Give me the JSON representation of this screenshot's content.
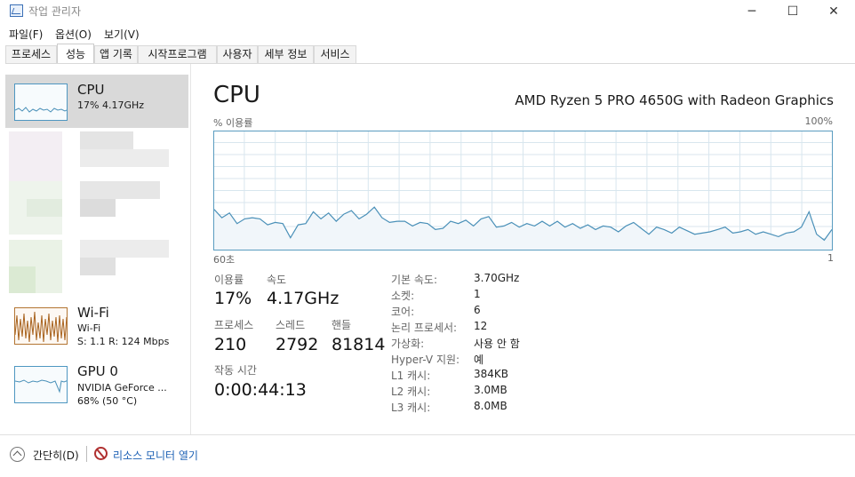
{
  "window": {
    "title": "작업 관리자",
    "minimize": "─",
    "maximize": "☐",
    "close": "✕"
  },
  "menu": [
    "파일(F)",
    "옵션(O)",
    "보기(V)"
  ],
  "tabs": [
    "프로세스",
    "성능",
    "앱 기록",
    "시작프로그램",
    "사용자",
    "세부 정보",
    "서비스"
  ],
  "active_tab": "성능",
  "sidebar": {
    "cpu": {
      "title": "CPU",
      "sub": "17% 4.17GHz"
    },
    "wifi": {
      "title": "Wi-Fi",
      "sub1": "Wi-Fi",
      "sub2": "S: 1.1  R: 124 Mbps"
    },
    "gpu": {
      "title": "GPU 0",
      "sub1": "NVIDIA GeForce ...",
      "sub2": "68% (50 °C)"
    }
  },
  "main": {
    "title": "CPU",
    "cpu_name": "AMD Ryzen 5 PRO 4650G with Radeon Graphics",
    "graph_top_left": "% 이용률",
    "graph_top_right": "100%",
    "graph_bottom_left": "60초",
    "graph_bottom_right": "1"
  },
  "stats": {
    "util_label": "이용률",
    "util_value": "17%",
    "speed_label": "속도",
    "speed_value": "4.17GHz",
    "proc_label": "프로세스",
    "proc_value": "210",
    "thread_label": "스레드",
    "thread_value": "2792",
    "handle_label": "핸들",
    "handle_value": "81814",
    "uptime_label": "작동 시간",
    "uptime_value": "0:00:44:13"
  },
  "specs": [
    {
      "label": "기본 속도:",
      "value": "3.70GHz"
    },
    {
      "label": "소켓:",
      "value": "1"
    },
    {
      "label": "코어:",
      "value": "6"
    },
    {
      "label": "논리 프로세서:",
      "value": "12"
    },
    {
      "label": "가상화:",
      "value": "사용 안 함"
    },
    {
      "label": "Hyper-V 지원:",
      "value": "예"
    },
    {
      "label": "L1 캐시:",
      "value": "384KB"
    },
    {
      "label": "L2 캐시:",
      "value": "3.0MB"
    },
    {
      "label": "L3 캐시:",
      "value": "8.0MB"
    }
  ],
  "footer": {
    "collapse": "간단히(D)",
    "resmon": "리소스 모니터 열기"
  },
  "chart_data": {
    "type": "area",
    "ylim": [
      0,
      100
    ],
    "values": [
      34,
      27,
      31,
      22,
      26,
      27,
      26,
      21,
      23,
      22,
      10,
      21,
      22,
      32,
      26,
      31,
      24,
      30,
      33,
      26,
      30,
      36,
      27,
      23,
      24,
      24,
      20,
      23,
      22,
      17,
      18,
      24,
      22,
      25,
      20,
      26,
      28,
      19,
      20,
      23,
      19,
      22,
      20,
      24,
      20,
      24,
      19,
      22,
      18,
      21,
      17,
      20,
      19,
      15,
      20,
      23,
      18,
      13,
      19,
      17,
      14,
      19,
      16,
      13,
      14,
      15,
      17,
      19,
      14,
      15,
      17,
      13,
      15,
      13,
      11,
      14,
      15,
      19,
      32,
      13,
      8,
      17
    ],
    "colors": {
      "line": "#4a90b8",
      "fill": "#f1f6fa",
      "grid": "#d8e6ee",
      "border": "#5a9cc0"
    }
  }
}
